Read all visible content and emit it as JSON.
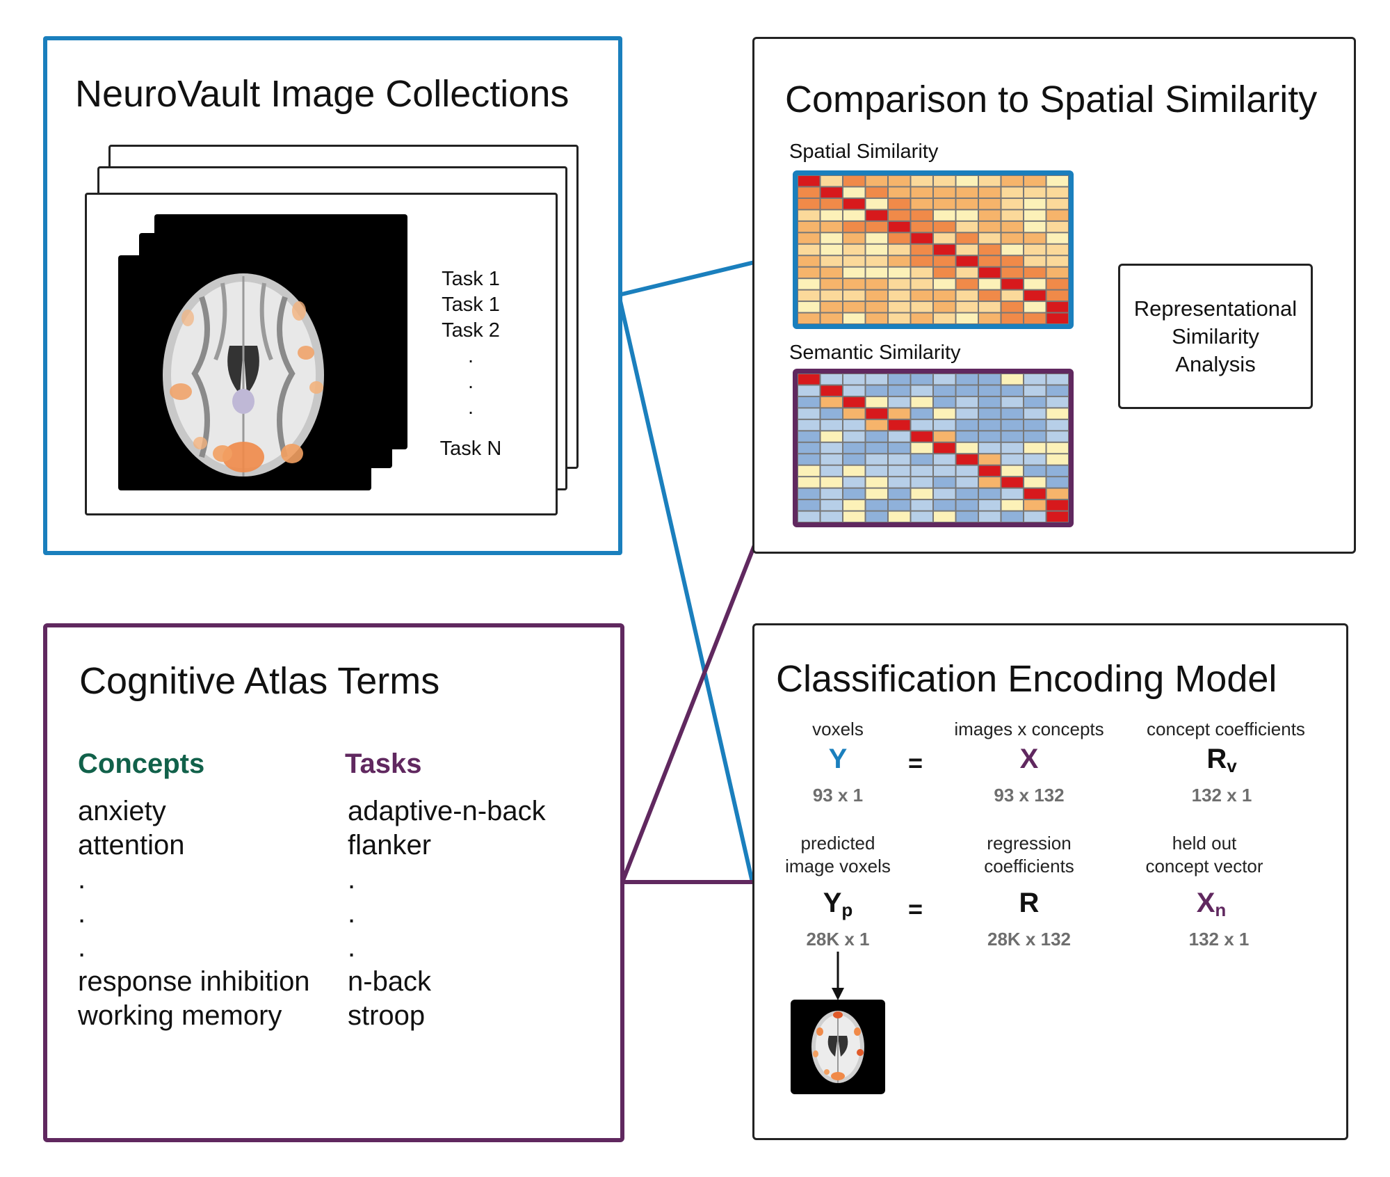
{
  "colors": {
    "blue": "#1a7fbd",
    "purple": "#60285f",
    "green": "#11614a",
    "dark": "#222222",
    "heat_red": "#d7191c",
    "heat_orange": "#f08a49",
    "heat_lightorange": "#f6b46b",
    "heat_yellow": "#fbd99a",
    "heat_paleyellow": "#fcf1b8",
    "heat_lightblue": "#b7cfe8",
    "heat_blue": "#8fb1da"
  },
  "neurovault": {
    "title": "NeuroVault Image Collections",
    "tasks": [
      "Task 1",
      "Task 1",
      "Task 2",
      ".",
      ".",
      ".",
      "Task N"
    ]
  },
  "comparison": {
    "title": "Comparison to Spatial Similarity",
    "spatial_label": "Spatial Similarity",
    "semantic_label": "Semantic Similarity",
    "rsa_lines": [
      "Representational",
      "Similarity",
      "Analysis"
    ]
  },
  "atlas": {
    "title": "Cognitive Atlas Terms",
    "concepts_header": "Concepts",
    "concepts": [
      "anxiety",
      "attention",
      ".",
      ".",
      ".",
      "response inhibition",
      "working memory"
    ],
    "tasks_header": "Tasks",
    "tasks": [
      "adaptive-n-back",
      "flanker",
      ".",
      ".",
      ".",
      "n-back",
      "stroop"
    ]
  },
  "encoding": {
    "title": "Classification Encoding Model",
    "equals": "=",
    "row1": {
      "left": {
        "top": "voxels",
        "sym": "Y",
        "sub": "",
        "dim": "93 x 1"
      },
      "mid": {
        "top": "images x concepts",
        "sym": "X",
        "sub": "",
        "dim": "93 x 132"
      },
      "right": {
        "top": "concept coefficients",
        "sym": "R",
        "sub": "v",
        "dim": "132 x 1"
      }
    },
    "row2": {
      "left": {
        "top1": "predicted",
        "top2": "image voxels",
        "sym": "Y",
        "sub": "p",
        "dim": "28K x 1"
      },
      "mid": {
        "top1": "regression",
        "top2": "coefficients",
        "sym": "R",
        "sub": "",
        "dim": "28K x 132"
      },
      "right": {
        "top1": "held out",
        "top2": "concept vector",
        "sym": "X",
        "sub": "n",
        "dim": "132 x 1"
      }
    }
  }
}
